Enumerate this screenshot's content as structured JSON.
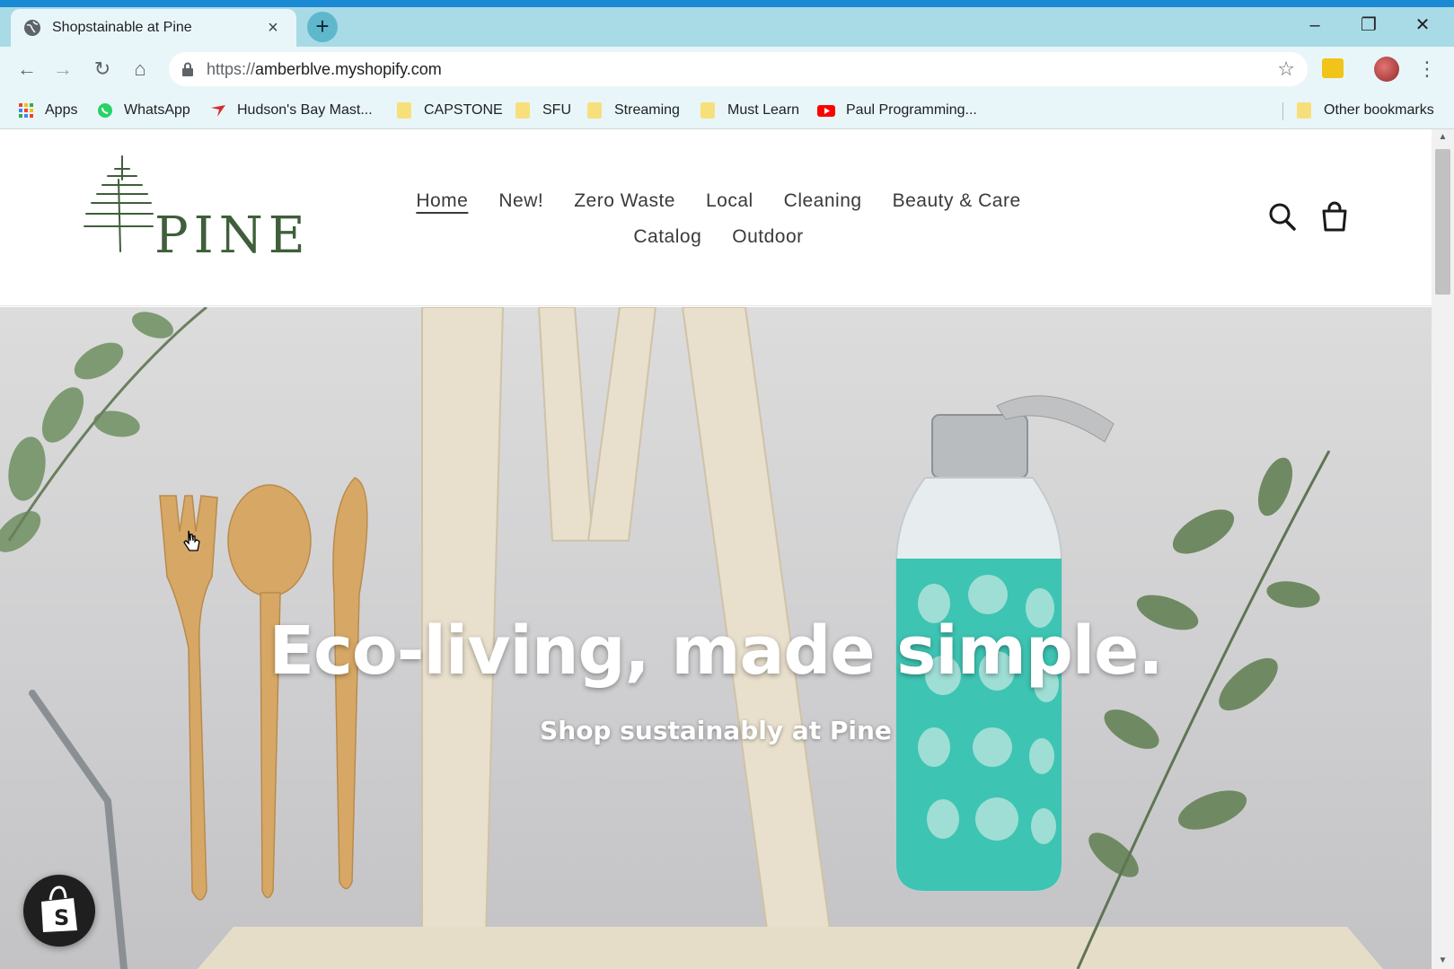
{
  "browser": {
    "tab": {
      "title": "Shopstainable at Pine",
      "close": "×"
    },
    "new_tab": "+",
    "window": {
      "minimize": "–",
      "restore": "❐",
      "close": "✕"
    },
    "toolbar": {
      "back": "←",
      "forward": "→",
      "reload": "↻",
      "home": "⌂",
      "star": "☆",
      "menu": "⋮"
    },
    "url": {
      "scheme": "https://",
      "host": "amberblve.myshopify.com"
    },
    "bookmarks": [
      {
        "label": "Apps",
        "icon": "apps-grid-icon"
      },
      {
        "label": "WhatsApp",
        "icon": "whatsapp-icon"
      },
      {
        "label": "Hudson's Bay Mast...",
        "icon": "hudsons-bay-icon"
      },
      {
        "label": "CAPSTONE",
        "icon": "folder-icon"
      },
      {
        "label": "SFU",
        "icon": "folder-icon"
      },
      {
        "label": "Streaming",
        "icon": "folder-icon"
      },
      {
        "label": "Must Learn",
        "icon": "folder-icon"
      },
      {
        "label": "Paul Programming...",
        "icon": "youtube-icon"
      }
    ],
    "other_bookmarks": "Other bookmarks"
  },
  "store": {
    "logo_text": "PINE",
    "nav": {
      "row1": [
        "Home",
        "New!",
        "Zero Waste",
        "Local",
        "Cleaning",
        "Beauty & Care"
      ],
      "row2": [
        "Catalog",
        "Outdoor"
      ]
    },
    "hero": {
      "title": "Eco-living, made simple.",
      "subtitle": "Shop sustainably at Pine"
    }
  },
  "colors": {
    "chrome": "#a8dbe6",
    "topline": "#1a8ad4",
    "teal_bottle": "#3ec4b3",
    "bamboo": "#d7a865",
    "leaf": "#6f8a62"
  }
}
